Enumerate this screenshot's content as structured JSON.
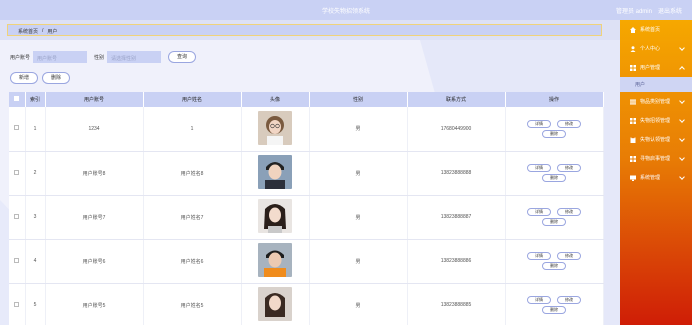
{
  "header": {
    "app_title": "学校失物招领系统",
    "user_label": "管理员 admin",
    "logout_label": "退出系统"
  },
  "breadcrumb": {
    "home": "系统首页",
    "separator": "/",
    "current": "用户"
  },
  "search": {
    "account_label": "用户账号",
    "account_placeholder": "用户账号",
    "gender_label": "性别",
    "gender_placeholder": "请选择性别",
    "query_button": "查询"
  },
  "actions": {
    "add": "新增",
    "delete": "删除"
  },
  "table": {
    "columns": [
      "索引",
      "用户账号",
      "用户姓名",
      "头像",
      "性别",
      "联系方式",
      "操作"
    ],
    "row_buttons": {
      "detail": "详情",
      "edit": "修改",
      "delete": "删除"
    },
    "rows": [
      {
        "index": "1",
        "account": "1234",
        "name": "1",
        "gender": "男",
        "phone": "17680449900"
      },
      {
        "index": "2",
        "account": "用户账号8",
        "name": "用户姓名8",
        "gender": "男",
        "phone": "13823888888"
      },
      {
        "index": "3",
        "account": "用户账号7",
        "name": "用户姓名7",
        "gender": "男",
        "phone": "13823888887"
      },
      {
        "index": "4",
        "account": "用户账号6",
        "name": "用户姓名6",
        "gender": "男",
        "phone": "13823888886"
      },
      {
        "index": "5",
        "account": "用户账号5",
        "name": "用户姓名5",
        "gender": "男",
        "phone": "13823888885"
      }
    ]
  },
  "sidebar": {
    "items": [
      {
        "label": "系统首页",
        "icon": "home-icon",
        "expandable": false
      },
      {
        "label": "个人中心",
        "icon": "user-icon",
        "expandable": true
      },
      {
        "label": "用户管理",
        "icon": "grid-icon",
        "expandable": true,
        "expanded": true,
        "sub": [
          "用户"
        ]
      },
      {
        "label": "物品类别管理",
        "icon": "list-icon",
        "expandable": true
      },
      {
        "label": "失物招领管理",
        "icon": "grid-icon",
        "expandable": true
      },
      {
        "label": "失物认领管理",
        "icon": "clipboard-icon",
        "expandable": true
      },
      {
        "label": "寻物启事管理",
        "icon": "grid-icon",
        "expandable": true
      },
      {
        "label": "系统管理",
        "icon": "monitor-icon",
        "expandable": true
      }
    ]
  },
  "colors": {
    "header_bg": "#c9d1f4",
    "sidebar_top": "#f6a800",
    "sidebar_bottom": "#cf1d06",
    "button_border": "#9aa6e0"
  }
}
